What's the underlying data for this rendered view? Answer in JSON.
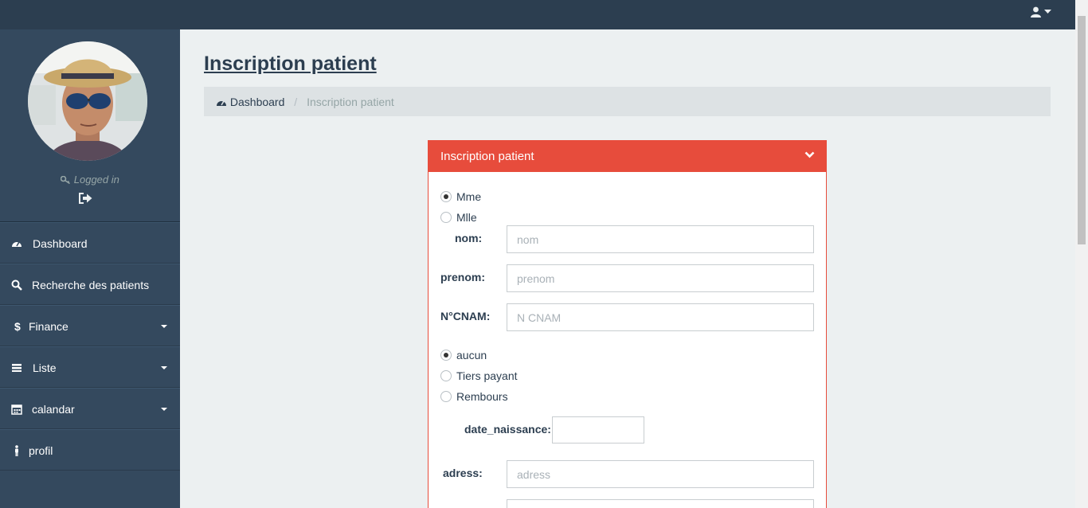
{
  "topbar": {
    "user_icon": "user-icon",
    "caret_icon": "caret-down-icon"
  },
  "sidebar": {
    "logged_in": "Logged in",
    "key_icon": "key-icon",
    "logout_icon": "sign-out-icon",
    "items": [
      {
        "label": "Dashboard",
        "icon": "dashboard-icon",
        "has_caret": false
      },
      {
        "label": "Recherche des patients",
        "icon": "search-icon",
        "has_caret": false
      },
      {
        "label": "Finance",
        "icon": "dollar-icon",
        "has_caret": true
      },
      {
        "label": "Liste",
        "icon": "list-icon",
        "has_caret": true
      },
      {
        "label": "calandar",
        "icon": "calendar-icon",
        "has_caret": true
      },
      {
        "label": "profil",
        "icon": "male-icon",
        "has_caret": false
      }
    ]
  },
  "page": {
    "title": "Inscription patient",
    "breadcrumb": {
      "home": "Dashboard",
      "current": "Inscription patient"
    }
  },
  "panel": {
    "title": "Inscription patient",
    "civilite": {
      "options": [
        "Mme",
        "Mlle"
      ],
      "selected": "Mme"
    },
    "nom": {
      "label": "nom:",
      "placeholder": "nom"
    },
    "prenom": {
      "label": "prenom:",
      "placeholder": "prenom"
    },
    "cnam": {
      "label": "N°CNAM:",
      "placeholder": "N CNAM"
    },
    "paiement": {
      "options": [
        "aucun",
        "Tiers payant",
        "Rembours"
      ],
      "selected": "aucun"
    },
    "date_naissance": {
      "label": "date_naissance:",
      "value": ""
    },
    "adress": {
      "label": "adress:",
      "placeholder": "adress"
    },
    "next_field": {
      "label": ""
    }
  },
  "colors": {
    "topbar": "#2c3e50",
    "sidebar": "#34495e",
    "accent": "#e74c3c",
    "background": "#ecf0f1"
  }
}
